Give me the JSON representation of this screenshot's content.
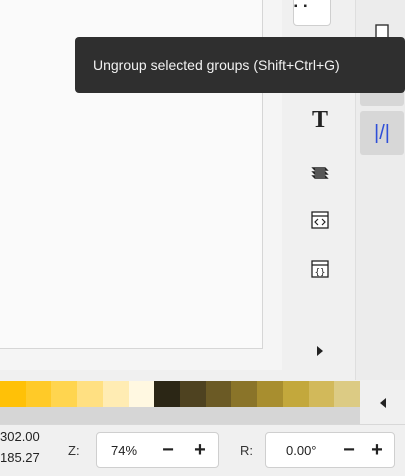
{
  "tooltip": {
    "text": "Ungroup selected groups (Shift+Ctrl+G)"
  },
  "toolbar": {
    "text_tool_glyph": "T",
    "icons": [
      "ungroup-icon",
      "text-tool-icon",
      "layers-icon",
      "xml-editor-icon",
      "object-properties-icon",
      "more-tools-arrow-icon"
    ]
  },
  "snapbar": {
    "icons": [
      "page-icon",
      "grid-icon",
      "guide-snap-icon"
    ],
    "guide_glyph": "|/|"
  },
  "palette": {
    "swatches": [
      "#ffc107",
      "#ffca28",
      "#ffd54f",
      "#ffe082",
      "#ffecb3",
      "#fff8e1",
      "#2b2615",
      "#4e4220",
      "#6b5a25",
      "#8a7429",
      "#a88e2f",
      "#c3a83c",
      "#d2b95a",
      "#dccb84"
    ]
  },
  "status": {
    "x_coord": "302.00",
    "y_coord": "185.27",
    "zoom_label": "Z:",
    "zoom_value": "74%",
    "rotation_label": "R:",
    "rotation_value": "0.00°",
    "minus": "−",
    "plus": "+"
  }
}
